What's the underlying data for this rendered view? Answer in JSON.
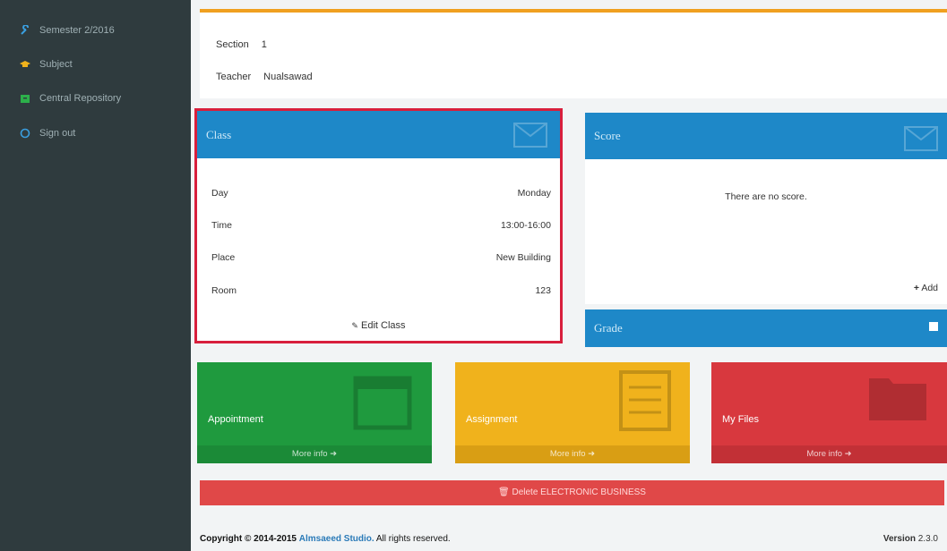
{
  "sidebar": {
    "items": [
      {
        "label": "Semester 2/2016",
        "icon": "wrench-icon"
      },
      {
        "label": "Subject",
        "icon": "graduation-cap-icon"
      },
      {
        "label": "Central Repository",
        "icon": "archive-icon"
      },
      {
        "label": "Sign out",
        "icon": "circle-icon"
      }
    ]
  },
  "info": {
    "section_label": "Section",
    "section_value": "1",
    "teacher_label": "Teacher",
    "teacher_value": "Nualsawad"
  },
  "class_panel": {
    "title": "Class",
    "rows": [
      {
        "label": "Day",
        "value": "Monday"
      },
      {
        "label": "Time",
        "value": "13:00-16:00"
      },
      {
        "label": "Place",
        "value": "New Building"
      },
      {
        "label": "Room",
        "value": "123"
      }
    ],
    "edit_label": "Edit Class"
  },
  "score_panel": {
    "title": "Score",
    "empty_text": "There are no score.",
    "add_label": "Add"
  },
  "grade_panel": {
    "title": "Grade"
  },
  "tiles": [
    {
      "title": "Appointment",
      "more": "More info",
      "color": "#1f9a3e"
    },
    {
      "title": "Assignment",
      "more": "More info",
      "color": "#f0b21c"
    },
    {
      "title": "My Files",
      "more": "More info",
      "color": "#d8383e"
    }
  ],
  "delete_bar": {
    "label": "Delete ELECTRONIC BUSINESS"
  },
  "footer": {
    "copyright_prefix": "Copyright © 2014-2015",
    "brand": "Almsaeed Studio.",
    "suffix": "All rights reserved.",
    "version_label": "Version",
    "version_value": "2.3.0"
  },
  "colors": {
    "sidebar_bg": "#2f3b3e",
    "blue_header": "#1e88c8",
    "highlight": "#d81f3c",
    "accent_line": "#f0a020"
  }
}
